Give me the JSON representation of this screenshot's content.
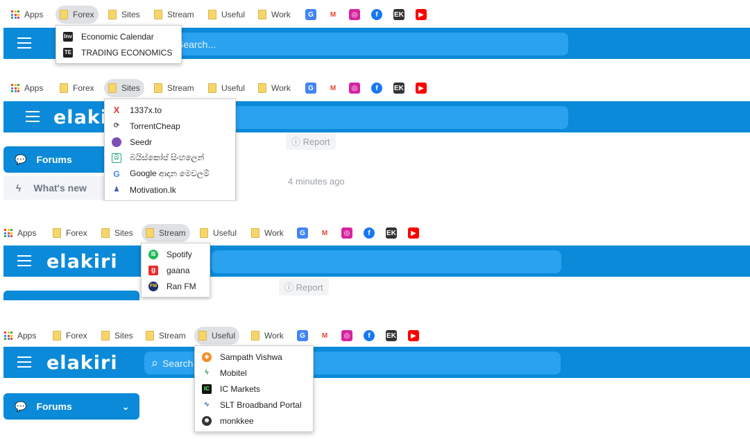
{
  "bookmarks": {
    "apps": "Apps",
    "forex": "Forex",
    "sites": "Sites",
    "stream": "Stream",
    "useful": "Useful",
    "work": "Work",
    "icons": [
      "google-translate-icon",
      "gmail-icon",
      "instagram-icon",
      "facebook-icon",
      "ek-icon",
      "youtube-icon"
    ]
  },
  "site": {
    "logo": "elakiri",
    "search_placeholder": "Search...",
    "search_short": "Search",
    "forums": "Forums",
    "whats_new": "What's new",
    "report": "Report",
    "time_ago": "4 minutes ago"
  },
  "menus": {
    "forex": [
      "Economic Calendar",
      "TRADING ECONOMICS"
    ],
    "sites": [
      "1337x.to",
      "TorrentCheap",
      "Seedr",
      "බයිස්කෝප් සිංහලෙන්",
      "Google ආදාන මෙවලම්",
      "Motivation.lk"
    ],
    "stream": [
      "Spotify",
      "gaana",
      "Ran FM"
    ],
    "useful": [
      "Sampath Vishwa",
      "Mobitel",
      "IC Markets",
      "SLT Broadband Portal",
      "monkkee"
    ]
  },
  "colors": {
    "header_blue": "#0a8ad8",
    "search_blue": "#2aa2ef",
    "folder": "#f6d66b"
  }
}
